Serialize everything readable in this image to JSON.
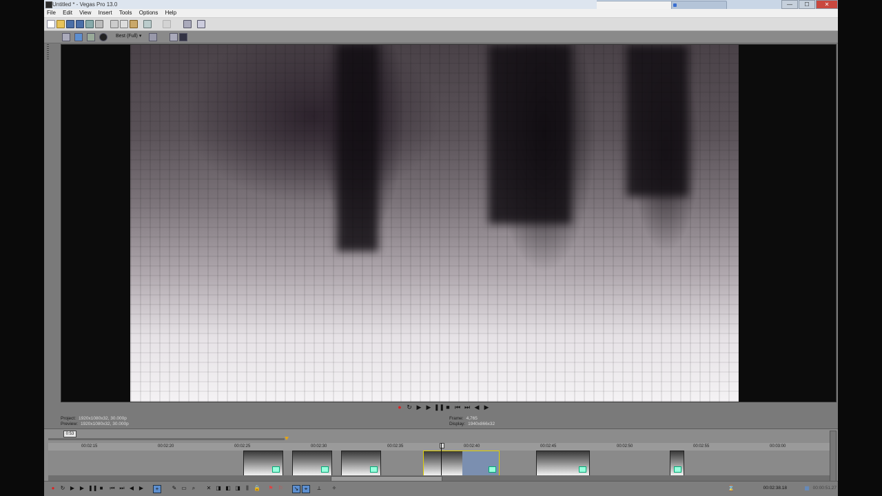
{
  "window": {
    "title": "Untitled * - Vegas Pro 13.0",
    "controls": [
      "—",
      "☐",
      "✕"
    ]
  },
  "browser_tabs": [
    {
      "label": "",
      "color": "#cc3333"
    },
    {
      "label": "",
      "color": "#3a6fd0"
    },
    {
      "label": "",
      "color": "#777"
    },
    {
      "label": "",
      "color": "#3a6fd0"
    },
    {
      "label": "",
      "color": "#cc3333"
    },
    {
      "label": "",
      "color": "#cc3333"
    },
    {
      "label": "",
      "color": "#cc3333"
    },
    {
      "label": "",
      "color": "#3a6fd0"
    }
  ],
  "menubar": [
    "File",
    "Edit",
    "View",
    "Insert",
    "Tools",
    "Options",
    "Help"
  ],
  "preview": {
    "quality": "Best (Full)"
  },
  "project_info": {
    "project_label": "Project:",
    "project_value": "1920x1080x32, 30.000p",
    "preview_label": "Preview:",
    "preview_value": "1920x1080x32, 30.000p",
    "frame_label": "Frame:",
    "frame_value": "4,765",
    "display_label": "Display:",
    "display_value": "1940x866x32"
  },
  "timeline": {
    "time_box": "0:53",
    "ruler_ticks": [
      "00:02:15",
      "00:02:20",
      "00:02:25",
      "00:02:30",
      "00:02:35",
      "00:02:40",
      "00:02:45",
      "00:02:50",
      "00:02:55",
      "00:03:00"
    ]
  },
  "status": {
    "cursor_time": "00:02:38.18",
    "end_time": "00:00:51.27"
  },
  "colors": {
    "accent_selected": "#e0d000",
    "record_red": "#d22222",
    "marker_orange": "#e3a417",
    "selection_blue": "#7b8fb0"
  }
}
